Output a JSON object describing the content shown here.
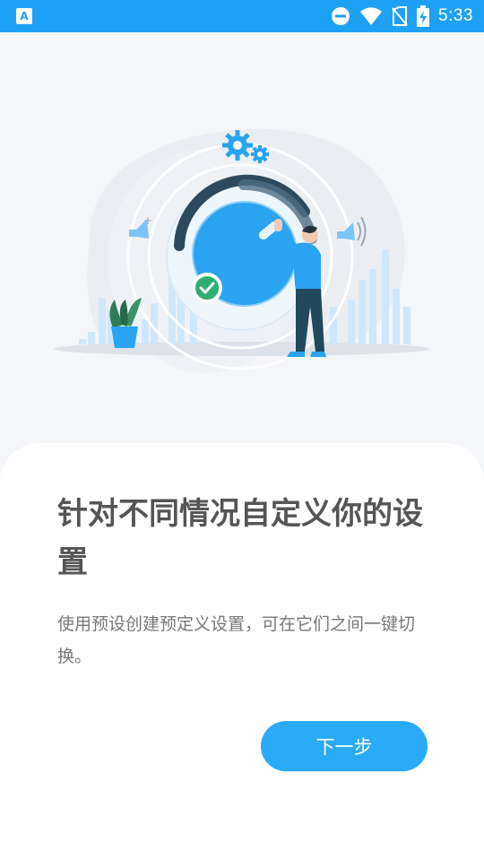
{
  "status_bar": {
    "time": "5:33",
    "app_badge": "A",
    "icons": [
      "app-notification-icon",
      "do-not-disturb-icon",
      "wifi-icon",
      "no-sim-icon",
      "battery-charging-icon"
    ]
  },
  "hero": {
    "illustration": "person-turning-volume-dial-illustration",
    "icons": [
      "gear-icon",
      "speaker-icon",
      "speaker-loud-icon",
      "check-badge-icon",
      "plant-icon"
    ]
  },
  "onboarding": {
    "title": "针对不同情况自定义你的设置",
    "description": "使用预设创建预定义设置，可在它们之间一键切换。",
    "next_button": "下一步"
  },
  "colors": {
    "accent": "#2aaaf7",
    "status_bar": "#1ea1f5",
    "background": "#f4f6f9",
    "card": "#ffffff",
    "title_text": "#555555",
    "body_text": "#777777",
    "check_green": "#2fae72"
  }
}
